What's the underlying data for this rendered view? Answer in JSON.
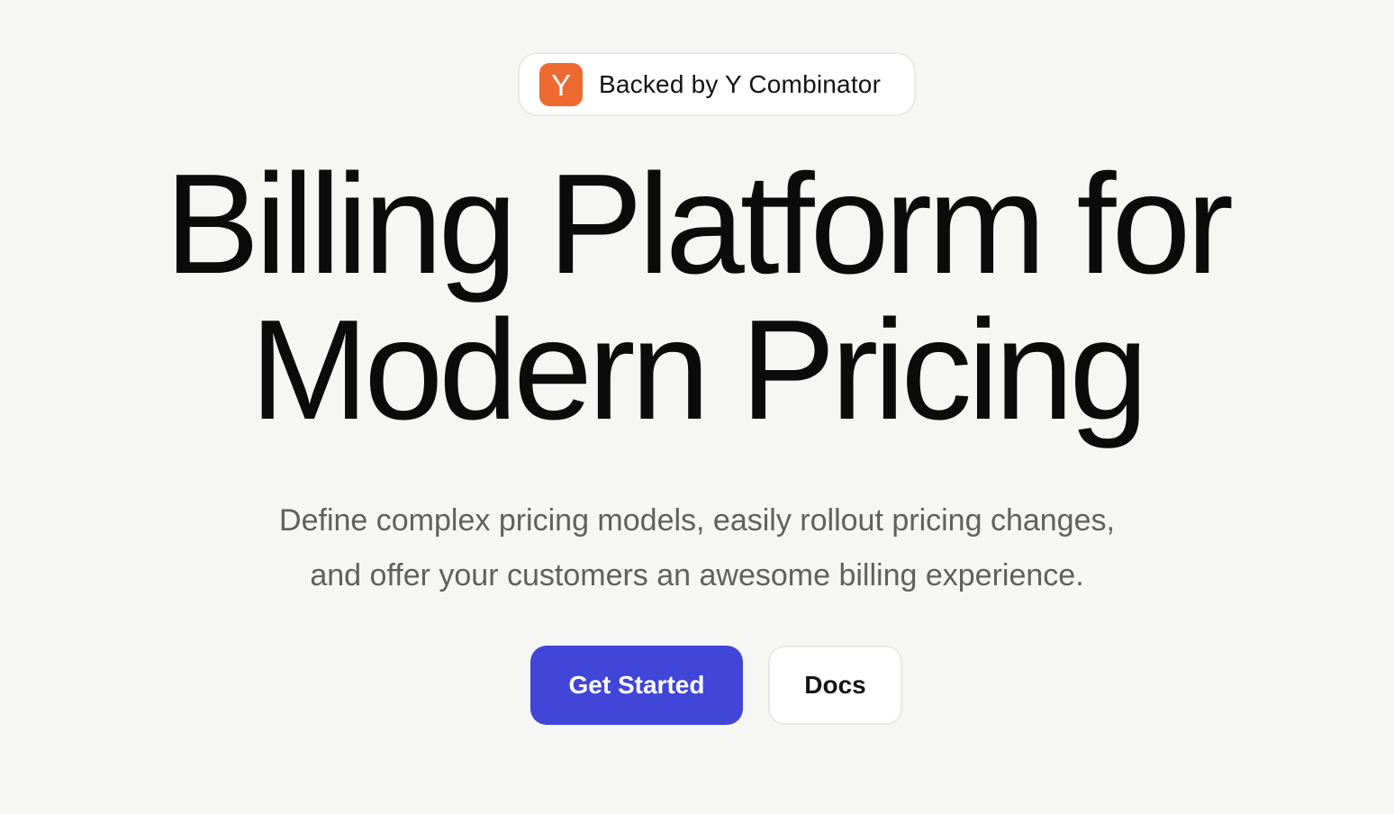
{
  "badge": {
    "logo_letter": "Y",
    "logo_color": "#ef6a30",
    "text": "Backed by Y Combinator"
  },
  "hero": {
    "headline_line1": "Billing Platform for",
    "headline_line2": "Modern Pricing",
    "subtitle_line1": "Define complex pricing models, easily rollout pricing changes,",
    "subtitle_line2": "and offer your customers an awesome billing experience."
  },
  "actions": {
    "primary_label": "Get Started",
    "primary_color": "#4145d8",
    "secondary_label": "Docs"
  },
  "colors": {
    "background": "#f6f6f4",
    "headline": "#0b0b0b",
    "subtitle": "#606060"
  }
}
